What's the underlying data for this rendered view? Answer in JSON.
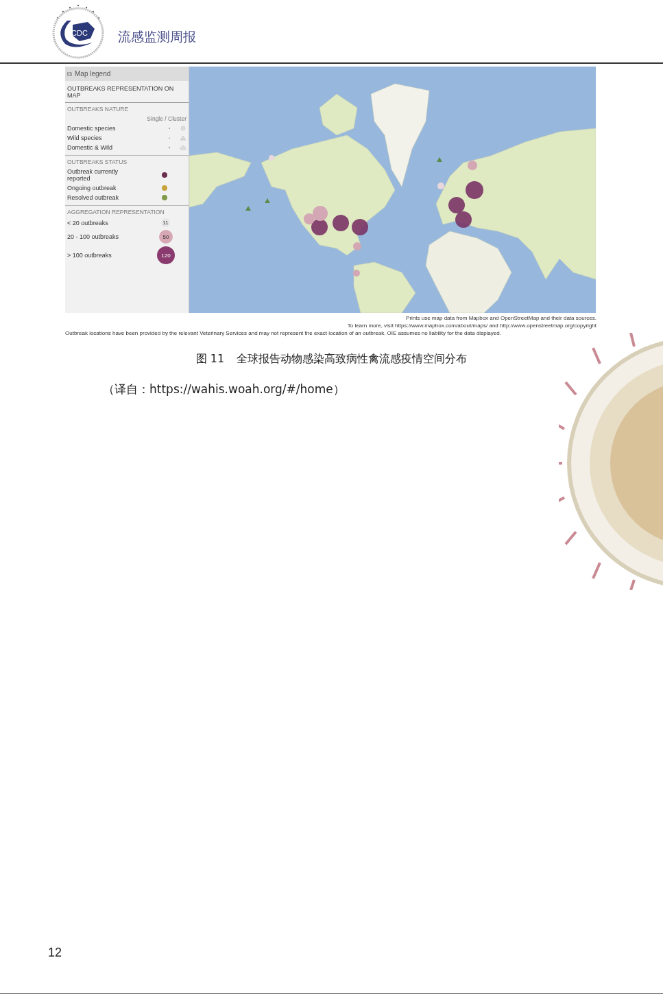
{
  "header": {
    "logo_text": "CDC",
    "title": "流感监测周报"
  },
  "figure": {
    "legend": {
      "title": "Map legend",
      "heading": "OUTBREAKS REPRESENTATION ON MAP",
      "nature": {
        "title": "OUTBREAKS NATURE",
        "column_header": "Single / Cluster",
        "items": [
          {
            "label": "Domestic species",
            "kind": "domestic"
          },
          {
            "label": "Wild species",
            "kind": "wild"
          },
          {
            "label": "Domestic & Wild",
            "kind": "both"
          }
        ]
      },
      "status": {
        "title": "OUTBREAKS STATUS",
        "items": [
          {
            "label": "Outbreak currently reported",
            "color": "#6b2f4e"
          },
          {
            "label": "Ongoing outbreak",
            "color": "#c9a23a"
          },
          {
            "label": "Resolved outbreak",
            "color": "#7f9a4a"
          }
        ]
      },
      "aggregation": {
        "title": "AGGREGATION REPRESENTATION",
        "items": [
          {
            "label": "< 20 outbreaks",
            "count": "11",
            "kind": "small"
          },
          {
            "label": "20 - 100 outbreaks",
            "count": "50",
            "kind": "medium"
          },
          {
            "label": "> 100 outbreaks",
            "count": "120",
            "kind": "large"
          }
        ]
      }
    },
    "attribution": [
      "Prints use map data from Mapbox and OpenStreetMap and their data sources.",
      "To learn more, visit https://www.mapbox.com/about/maps/ and http://www.openstreetmap.org/copyright"
    ],
    "disclaimer": "Outbreak locations have been provided by the relevant Veterinary Services and may not represent the exact location of an outbreak. OIE assumes no liability for the data displayed."
  },
  "caption": {
    "number": "图 11",
    "text": "全球报告动物感染高致病性禽流感疫情空间分布"
  },
  "source": "（译自：https://wahis.woah.org/#/home）",
  "page_number": "12"
}
